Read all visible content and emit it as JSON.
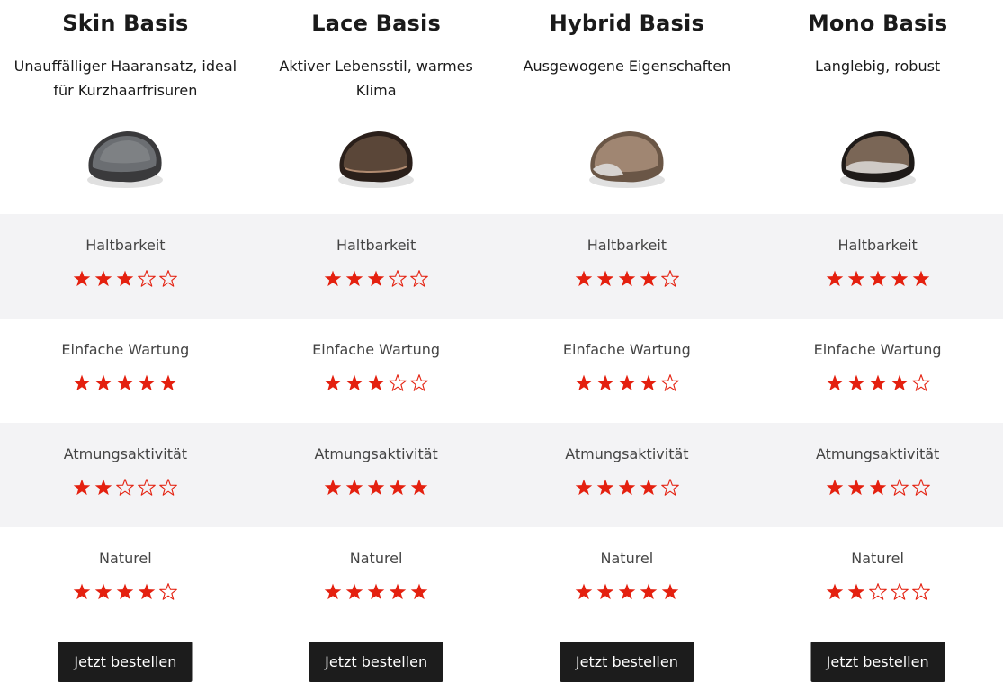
{
  "colors": {
    "star": "#e4200f",
    "button_bg": "#1c1c1c",
    "shaded_row": "#f3f3f5"
  },
  "products": [
    {
      "title": "Skin Basis",
      "description": "Unauffälliger Haaransatz, ideal für Kurzhaarfrisuren",
      "image_icon": "skin-base-hairpiece",
      "ratings": [
        {
          "label": "Haltbarkeit",
          "stars": 3
        },
        {
          "label": "Einfache Wartung",
          "stars": 5
        },
        {
          "label": "Atmungsaktivität",
          "stars": 2
        },
        {
          "label": "Naturel",
          "stars": 4
        }
      ],
      "button_label": "Jetzt bestellen"
    },
    {
      "title": "Lace Basis",
      "description": "Aktiver Lebensstil, warmes Klima",
      "image_icon": "lace-base-hairpiece",
      "ratings": [
        {
          "label": "Haltbarkeit",
          "stars": 3
        },
        {
          "label": "Einfache Wartung",
          "stars": 3
        },
        {
          "label": "Atmungsaktivität",
          "stars": 5
        },
        {
          "label": "Naturel",
          "stars": 5
        }
      ],
      "button_label": "Jetzt bestellen"
    },
    {
      "title": "Hybrid Basis",
      "description": "Ausgewogene Eigenschaften",
      "image_icon": "hybrid-base-hairpiece",
      "ratings": [
        {
          "label": "Haltbarkeit",
          "stars": 4
        },
        {
          "label": "Einfache Wartung",
          "stars": 4
        },
        {
          "label": "Atmungsaktivität",
          "stars": 4
        },
        {
          "label": "Naturel",
          "stars": 5
        }
      ],
      "button_label": "Jetzt bestellen"
    },
    {
      "title": "Mono Basis",
      "description": "Langlebig, robust",
      "image_icon": "mono-base-hairpiece",
      "ratings": [
        {
          "label": "Haltbarkeit",
          "stars": 5
        },
        {
          "label": "Einfache Wartung",
          "stars": 4
        },
        {
          "label": "Atmungsaktivität",
          "stars": 3
        },
        {
          "label": "Naturel",
          "stars": 2
        }
      ],
      "button_label": "Jetzt bestellen"
    }
  ]
}
